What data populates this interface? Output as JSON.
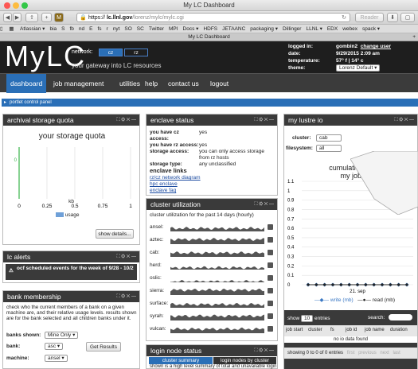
{
  "browser": {
    "window_title": "My LC Dashboard",
    "url_scheme": "https",
    "url_host": "lc.llnl.gov",
    "url_path": "/lorenz/mylc/mylc.cgi",
    "reader_label": "Reader",
    "bookmarks": [
      "Atlassian ▾",
      "bia",
      "S",
      "fb",
      "nd",
      "E",
      "fs",
      "r",
      "nyt",
      "SO",
      "SC",
      "Twitter",
      "MPI",
      "Docs ▾",
      "HDFS",
      "JETAANC",
      "packaging ▾",
      "Dillinger",
      "LLNL ▾",
      "EDX",
      "webex",
      "spack ▾"
    ],
    "tab_title": "My LC Dashboard"
  },
  "header": {
    "logo": "MyLC",
    "network_label": "network:",
    "networks": [
      "cz",
      "rz"
    ],
    "tagline": "your gateway into LC resources",
    "info": [
      {
        "key": "logged in:",
        "value": "gombin2",
        "link": "change user"
      },
      {
        "key": "date:",
        "value": "9/29/2015 2:09 am"
      },
      {
        "key": "temperature:",
        "value": "57° f | 14° c"
      },
      {
        "key": "theme:",
        "value": "Lorenz Default ▾"
      }
    ]
  },
  "nav": {
    "items": [
      "dashboard",
      "job management",
      "utilities",
      "help",
      "contact us",
      "logout"
    ],
    "active": "dashboard"
  },
  "portlet_control": "portlet control panel",
  "archival": {
    "title": "archival storage quota",
    "chart_title": "your storage quota",
    "xlabel": "kb",
    "legend": "usage",
    "show_details": "show details..."
  },
  "chart_data": [
    {
      "type": "bar",
      "title": "your storage quota",
      "xlabel": "kb",
      "ylabel": "",
      "xlim": [
        0,
        1
      ],
      "x_ticks": [
        "0",
        "0.25",
        "0.5",
        "0.75",
        "1"
      ],
      "series": [
        {
          "name": "usage",
          "values": [
            0
          ]
        }
      ],
      "color": "#6fa0d8",
      "grid": true,
      "legend": "bottom"
    },
    {
      "type": "line",
      "title": "cumulative lustre i/o my jobs for...",
      "y_ticks": [
        "1.1",
        "1",
        "0.9",
        "0.8",
        "0.7",
        "0.6",
        "0.5",
        "0.4",
        "0.3",
        "0.2",
        "0.1",
        "0"
      ],
      "ylim": [
        0,
        1.1
      ],
      "x_tick": "21. sep",
      "series": [
        {
          "name": "write (mb)",
          "values": [
            0,
            0,
            0,
            0,
            0,
            0,
            0,
            0,
            0,
            0,
            0,
            0,
            0
          ],
          "color": "#3b78c4"
        },
        {
          "name": "read (mb)",
          "values": [
            0,
            0,
            0,
            0,
            0,
            0,
            0,
            0,
            0,
            0,
            0,
            0,
            0
          ],
          "color": "#222222"
        }
      ],
      "grid": true,
      "legend": "bottom"
    }
  ],
  "enclave": {
    "title": "enclave status",
    "rows": [
      {
        "key": "you have cz access:",
        "value": "yes"
      },
      {
        "key": "you have rz access:",
        "value": "yes"
      },
      {
        "key": "storage access:",
        "value": "you can only access storage from rz hosts"
      },
      {
        "key": "storage type:",
        "value": "any unclassified"
      }
    ],
    "links_title": "enclave links",
    "links": [
      "rz/cz network diagram",
      "hpc enclave",
      "enclave faq"
    ]
  },
  "cluster_util": {
    "title": "cluster utilization",
    "subtitle": "cluster utilization for the past 14 days (hourly)",
    "clusters": [
      "ansel:",
      "aztec:",
      "cab:",
      "herd:",
      "oslic:",
      "sierra:",
      "surface:",
      "syrah:",
      "vulcan:"
    ]
  },
  "lustre": {
    "title": "my lustre io",
    "cluster_label": "cluster:",
    "cluster_value": "cab",
    "fs_label": "filesystem:",
    "fs_value": "all",
    "chart_title_1": "cumulative lustre i/o",
    "chart_title_2": "my jobs for...",
    "legend_write": "write (mb)",
    "legend_read": "read (mb)",
    "show_label": "show",
    "show_value": "10",
    "entries_label": "entries",
    "search_label": "search:",
    "table_headers": [
      "job start",
      "cluster",
      "fs",
      "job id",
      "job name",
      "duration"
    ],
    "empty_text": "no io data found",
    "footer_info": "showing 0 to 0 of 0 entries",
    "pager": [
      "first",
      "previous",
      "next",
      "last"
    ]
  },
  "lc_alerts": {
    "title": "lc alerts",
    "alert": "ocf scheduled events for the week of 9/28 - 10/2"
  },
  "bank": {
    "title": "bank membership",
    "desc": "check who the current members of a bank on a given machine are, and their relative usage levels. results shown are for the bank selected and all children banks under it.",
    "banks_shown_label": "banks shown:",
    "banks_shown_value": "Mine Only ▾",
    "bank_label": "bank:",
    "bank_value": "asc ▾",
    "machine_label": "machine:",
    "machine_value": "ansel ▾",
    "get_results": "Get Results"
  },
  "login_node": {
    "title": "login node status",
    "tabs": [
      "cluster summary",
      "login nodes by cluster"
    ],
    "desc": "shown is a high level summary of total and unavailable login nodes for all clusters."
  }
}
